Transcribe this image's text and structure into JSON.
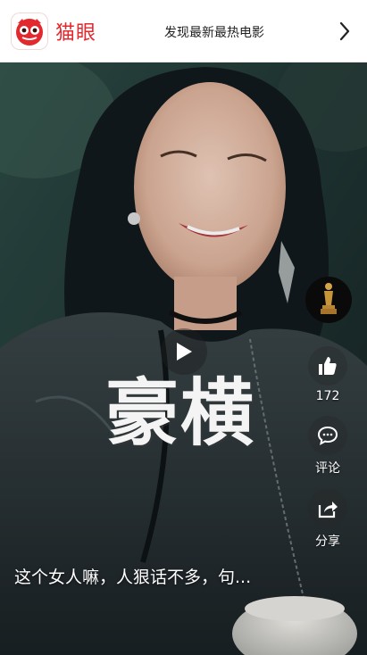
{
  "header": {
    "logo_text": "猫眼",
    "title": "发现最新最热电影",
    "next_icon": "chevron-right-icon"
  },
  "video": {
    "overlay_title": "豪横",
    "caption": "这个女人嘛，人狠话不多，句...",
    "play_icon": "play-icon"
  },
  "actions": {
    "avatar_icon": "oscar-trophy-icon",
    "like_count": "172",
    "comment_label": "评论",
    "share_label": "分享"
  },
  "colors": {
    "brand": "#e3282e",
    "header_bg": "#ffffff"
  }
}
